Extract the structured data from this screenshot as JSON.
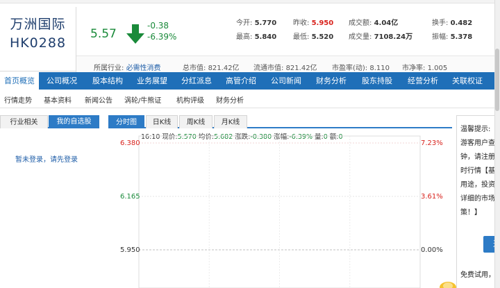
{
  "stock": {
    "name": "万洲国际",
    "code": "HK0288",
    "price": "5.57",
    "change": "-0.38",
    "change_pct": "-6.39%"
  },
  "quote": {
    "open_label": "今开:",
    "open": "5.770",
    "prev_label": "昨收:",
    "prev": "5.950",
    "turnover_label": "成交额:",
    "turnover": "4.04亿",
    "exchange_label": "换手:",
    "exchange": "0.482",
    "high_label": "最高:",
    "high": "5.840",
    "low_label": "最低:",
    "low": "5.520",
    "volume_label": "成交量:",
    "volume": "7108.24万",
    "amplitude_label": "振幅:",
    "amplitude": "5.378"
  },
  "industry": {
    "label": "所属行业:",
    "value": "必需性消费",
    "mktcap_label": "总市值:",
    "mktcap": "821.42亿",
    "float_label": "流通市值:",
    "float_cap": "821.42亿",
    "pe_label": "市盈率(动):",
    "pe": "8.110",
    "pb_label": "市净率:",
    "pb": "1.005"
  },
  "main_nav": [
    "首页概览",
    "公司概况",
    "股本结构",
    "业务展望",
    "分红派息",
    "高管介绍",
    "公司新闻",
    "财务分析",
    "股东持股",
    "经营分析",
    "关联权证"
  ],
  "sub_nav": [
    "行情走势",
    "基本资料",
    "新闻公告",
    "涡轮/牛熊证",
    "机构评级",
    "财务分析"
  ],
  "left_tabs": {
    "industry": "行业相关",
    "watchlist": "我的自选股"
  },
  "login_msg": "暂未登录，请先登录",
  "chart_tabs": [
    "分时图",
    "日K线",
    "周K线",
    "月K线"
  ],
  "chart_info": {
    "time": "16:10",
    "price_label": "现价:",
    "price": "5.570",
    "avg_label": "均价:",
    "avg": "5.682",
    "chg_label": "涨跌:",
    "chg": "-0.380",
    "pct_label": "涨幅:",
    "pct": "-6.39%",
    "vol_label": "量:",
    "vol": "0",
    "amt_label": "额:",
    "amt": "0"
  },
  "chart_data": {
    "type": "line",
    "y_left_ticks": [
      "6.380",
      "6.165",
      "5.950"
    ],
    "y_right_ticks": [
      "7.23%",
      "3.61%",
      "0.00%"
    ],
    "series": []
  },
  "tip": {
    "title": "温馨提示:",
    "lines": [
      "游客用户查看",
      "钟，请注册并",
      "时行情【基本",
      "用途，投资者",
      "详细的市场信",
      "策！】"
    ],
    "button": "进",
    "footer": "免费试用，申"
  },
  "colors": {
    "nav_blue": "#1f6fb8",
    "up_red": "#d8221c",
    "down_green": "#1a8a3a"
  }
}
